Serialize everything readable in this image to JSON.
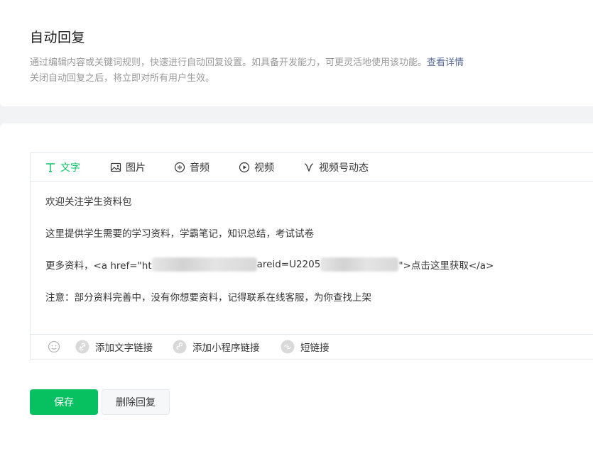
{
  "header": {
    "title": "自动回复",
    "desc_line1": "通过编辑内容或关键词规则，快速进行自动回复设置。如具备开发能力，可更灵活地使用该功能。",
    "desc_link": "查看详情",
    "desc_line2": "关闭自动回复之后，将立即对所有用户生效。"
  },
  "editor": {
    "tabs": [
      {
        "label": "文字",
        "icon": "text-icon",
        "active": true
      },
      {
        "label": "图片",
        "icon": "image-icon"
      },
      {
        "label": "音频",
        "icon": "audio-icon"
      },
      {
        "label": "视频",
        "icon": "video-icon"
      },
      {
        "label": "视频号动态",
        "icon": "channels-icon"
      }
    ],
    "content": {
      "line1": "欢迎关注学生资料包",
      "line2": "这里提供学生需要的学习资料，学霸笔记，知识总结，考试试卷",
      "line3_a": "更多资料，<a href=\"ht",
      "line3_b": "areid=U2205",
      "line3_c": "\">点击这里获取</a>",
      "line4": "注意：部分资料完善中，没有你想要资料，记得联系在线客服，为你查找上架"
    },
    "toolbar": {
      "add_text_link": "添加文字链接",
      "add_mini_link": "添加小程序链接",
      "short_link": "短链接"
    }
  },
  "actions": {
    "save": "保存",
    "delete": "删除回复"
  },
  "colors": {
    "accent": "#07c160",
    "link": "#576b95"
  }
}
